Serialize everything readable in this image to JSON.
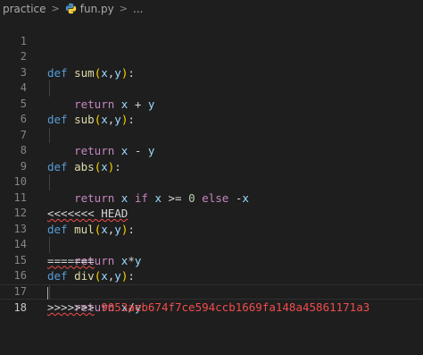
{
  "breadcrumb": {
    "folder": "practice",
    "file": "fun.py",
    "more": "..."
  },
  "editor": {
    "active_line": "18",
    "lines": [
      {
        "n": "1"
      },
      {
        "n": "2",
        "def": "def",
        "fname": "sum",
        "p1": "x",
        "p2": "y"
      },
      {
        "n": "3",
        "ret": "return",
        "a": "x",
        "op": "+",
        "b": "y"
      },
      {
        "n": "4"
      },
      {
        "n": "5",
        "def": "def",
        "fname": "sub",
        "p1": "x",
        "p2": "y"
      },
      {
        "n": "6",
        "ret": "return",
        "a": "x",
        "op": "-",
        "b": "y"
      },
      {
        "n": "7"
      },
      {
        "n": "8",
        "def": "def",
        "fname": "abs",
        "p1": "x"
      },
      {
        "n": "9",
        "ret": "return",
        "a": "x",
        "if": "if",
        "b": "x",
        "op": ">=",
        "num": "0",
        "else": "else",
        "neg": "-",
        "c": "x"
      },
      {
        "n": "10"
      },
      {
        "n": "11",
        "marker": "<<<<<<< HEAD"
      },
      {
        "n": "12",
        "def": "def",
        "fname": "mul",
        "p1": "x",
        "p2": "y"
      },
      {
        "n": "13",
        "ret": "return",
        "a": "x",
        "op": "*",
        "b": "y"
      },
      {
        "n": "14",
        "marker": "======="
      },
      {
        "n": "15",
        "def": "def",
        "fname": "div",
        "p1": "x",
        "p2": "y"
      },
      {
        "n": "16",
        "ret": "return",
        "a": "x",
        "op": "/",
        "b": "y"
      },
      {
        "n": "17",
        "marker": ">>>>>>>",
        "hash": "9053aeb674f7ce594ccb1669fa148a45861171a3"
      },
      {
        "n": "18"
      }
    ]
  },
  "colors": {
    "background": "#1e1e1e",
    "keyword_def": "#569cd6",
    "keyword_control": "#c586c0",
    "function": "#dcdcaa",
    "variable": "#9cdcfe",
    "number": "#b5cea8",
    "error": "#f14c4c"
  }
}
